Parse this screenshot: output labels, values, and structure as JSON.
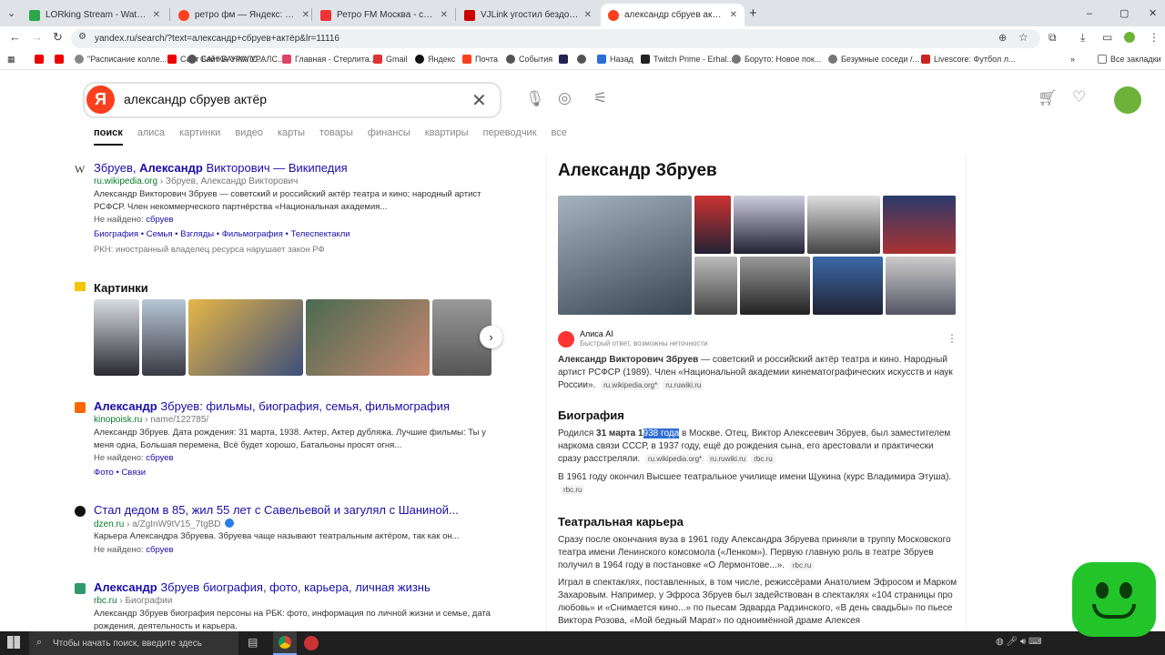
{
  "tabs": [
    {
      "title": "LORking Stream - Watch Live o",
      "color": "#2aa84a"
    },
    {
      "title": "ретро фм — Яндекс: нашлось",
      "color": "#fc3f1d"
    },
    {
      "title": "Ретро FM Москва - слушать он",
      "color": "#e33"
    },
    {
      "title": "VJLink угостил бездомных и к",
      "color": "#c00"
    },
    {
      "title": "александр сбруев актёр — Ян",
      "color": "#fc3f1d"
    }
  ],
  "window": {
    "new_tab": "+",
    "min": "–",
    "max": "▢",
    "close": "✕",
    "restore": "⌄"
  },
  "address": {
    "url": "yandex.ru/search/?text=александр+сбруев+актёр&lr=11116"
  },
  "bookmarks": [
    "\"Расписание колле...",
    "Сайт БАНКА УРАЛС...",
    "Главная - Стерлита...",
    "Gmail",
    "Яндекс",
    "Почта",
    "События",
    "Назад",
    "Twitch Prime - Erhal...",
    "Боруто: Новое пок...",
    "Безумные соседи /...",
    "Livescore: Футбол л...",
    "Все закладки"
  ],
  "search": {
    "logo": "Я",
    "query": "александр сбруев актёр"
  },
  "verticals": [
    "поиск",
    "алиса",
    "картинки",
    "видео",
    "карты",
    "товары",
    "финансы",
    "квартиры",
    "переводчик",
    "все"
  ],
  "results": [
    {
      "title_pre": "Збруев, ",
      "title_bold": "Александр",
      "title_post": " Викторович — Википедия",
      "src": "ru.wikipedia.org",
      "path": " › Збруев, Александр Викторович",
      "snip": "Александр Викторович Збруев — советский и российский актёр театра и кино; народный артист РСФСР. Член некоммерческого партнёрства «Национальная академия...",
      "nf_label": "Не найдено:",
      "nf_word": "сбруев",
      "links": "Биография  •  Семья  •  Взгляды  •  Фильмография  •  Телеспектакли",
      "rkn": "РКН: иностранный владелец ресурса нарушает закон РФ"
    },
    {
      "title_pre": "",
      "title_bold": "Александр",
      "title_post": " Збруев: фильмы, биография, семья, фильмография",
      "src": "kinopoisk.ru",
      "path": " › name/122785/",
      "snip": "Александр Збруев. Дата рождения: 31 марта, 1938. Актер, Актер дубляжа. Лучшие фильмы: Ты у меня одна, Большая перемена, Всё будет хорошо, Батальоны просят огня...",
      "nf_label": "Не найдено:",
      "nf_word": "сбруев",
      "links": "Фото  •  Связи"
    },
    {
      "title_pre": "Стал дедом в 85, жил 55 лет с Савельевой и загулял с Шаниной...",
      "title_bold": "",
      "title_post": "",
      "src": "dzen.ru",
      "path": " › a/ZgInW9tV15_7tgBD",
      "snip": "Карьера Александра Збруева. Збруева чаще называют театральным актёром, так как он...",
      "nf_label": "Не найдено:",
      "nf_word": "сбруев"
    },
    {
      "title_pre": "",
      "title_bold": "Александр",
      "title_post": " Збруев биография, фото, карьера, личная жизнь",
      "src": "rbc.ru",
      "path": " › Биографии",
      "snip": "Александр Збруев биография персоны на РБК: фото, информация по личной жизни и семье, дата рождения, деятельность и карьера."
    }
  ],
  "pictures_title": "Картинки",
  "panel": {
    "title": "Александр Збруев",
    "alice_name": "Алиса AI",
    "alice_sub": "Быстрый ответ, возможны неточности",
    "intro_bold": "Александр Викторович Збруев",
    "intro": " — советский и российский актёр театра и кино. Народный артист РСФСР (1989). Член «Национальной академии кинематографических искусств и наук России».",
    "chip_wiki": "ru.wikipedia.org*",
    "chip_ruwiki": "ru.ruwiki.ru",
    "chip_rbc": "rbc.ru",
    "bio_h": "Биография",
    "bio1_a": "Родился ",
    "bio1_bold": "31 марта 1",
    "bio1_hl": "938 года",
    "bio1_b": " в Москве. Отец, Виктор Алексеевич Збруев, был заместителем наркома связи СССР, в 1937 году, ещё до рождения сына, его арестовали и практически сразу расстреляли.",
    "bio2": "В 1961 году окончил Высшее театральное училище имени Щукина (курс Владимира Этуша).",
    "theatre_h": "Театральная карьера",
    "th1": "Сразу после окончания вуза в 1961 году Александра Збруева приняли в труппу Московского театра имени Ленинского комсомола («Ленком»). Первую главную роль в театре Збруев получил в 1964 году в постановке «О Лермонтове...».",
    "th2": "Играл в спектаклях, поставленных, в том числе, режиссёрами Анатолием Эфросом и Марком Захаровым. Например, у Эфроса Збруев был задействован в спектаклях «104 страницы про любовь» и «Снимается кино...» по пьесам Эдварда Радзинского, «В день свадьбы» по пьесе Виктора Розова, «Мой бедный Марат» по одноимённой драме Алексея"
  },
  "taskbar": {
    "search": "Чтобы начать поиск, введите здесь"
  }
}
